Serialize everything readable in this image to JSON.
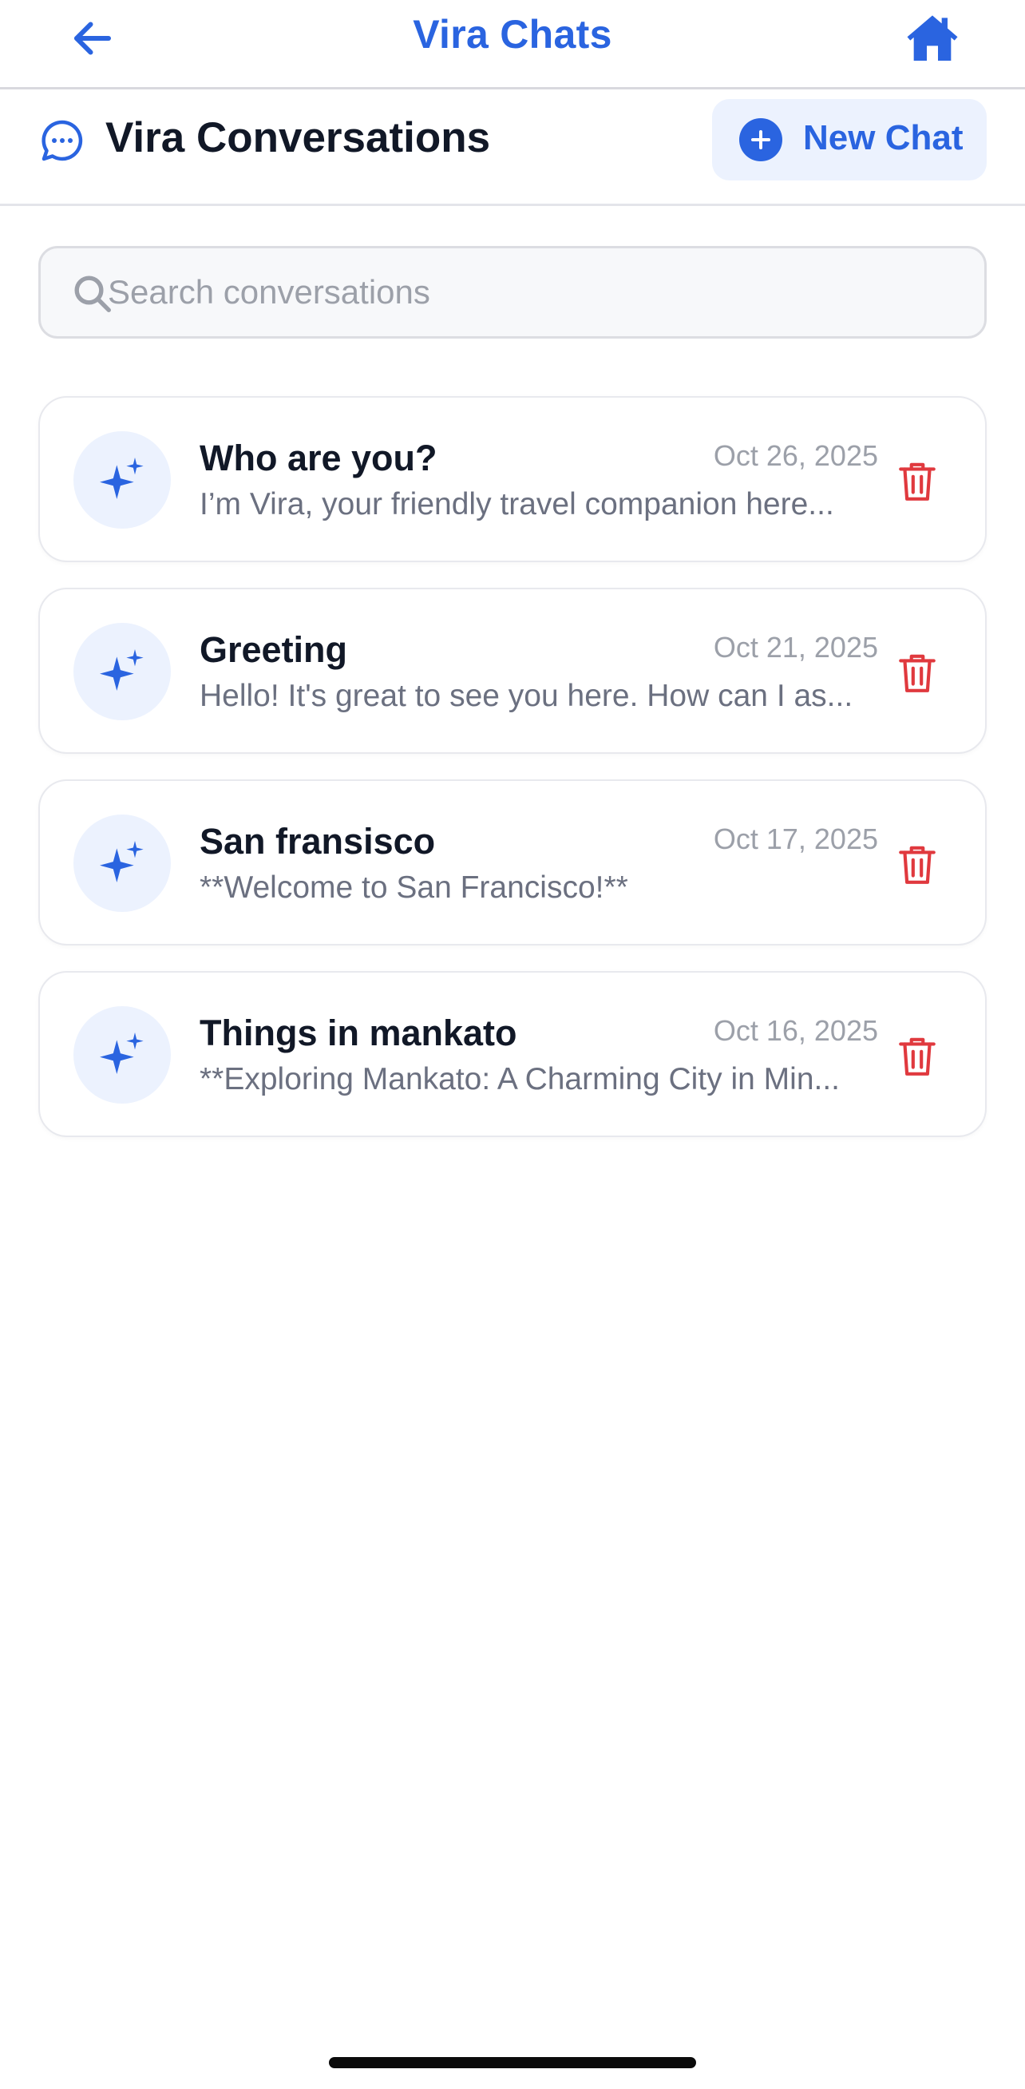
{
  "topbar": {
    "title": "Vira Chats",
    "back_icon": "arrow-left-icon",
    "home_icon": "home-icon"
  },
  "header": {
    "title": "Vira Conversations",
    "icon": "chat-bubble-icon",
    "new_chat_label": "New Chat"
  },
  "search": {
    "placeholder": "Search conversations",
    "value": ""
  },
  "conversations": [
    {
      "title": "Who are you?",
      "date": "Oct 26, 2025",
      "preview": "I’m Vira, your friendly travel companion here..."
    },
    {
      "title": "Greeting",
      "date": "Oct 21, 2025",
      "preview": "Hello! It's great to see you here. How can I as..."
    },
    {
      "title": "San fransisco",
      "date": "Oct 17, 2025",
      "preview": "**Welcome to San Francisco!**"
    },
    {
      "title": "Things in mankato",
      "date": "Oct 16, 2025",
      "preview": "**Exploring Mankato: A Charming City in Min..."
    }
  ],
  "colors": {
    "accent": "#2a64e0",
    "accent_soft": "#ecf2fe",
    "danger": "#e0393e",
    "text_primary": "#111827",
    "text_secondary": "#6b7080",
    "text_muted": "#9ca0a9"
  }
}
